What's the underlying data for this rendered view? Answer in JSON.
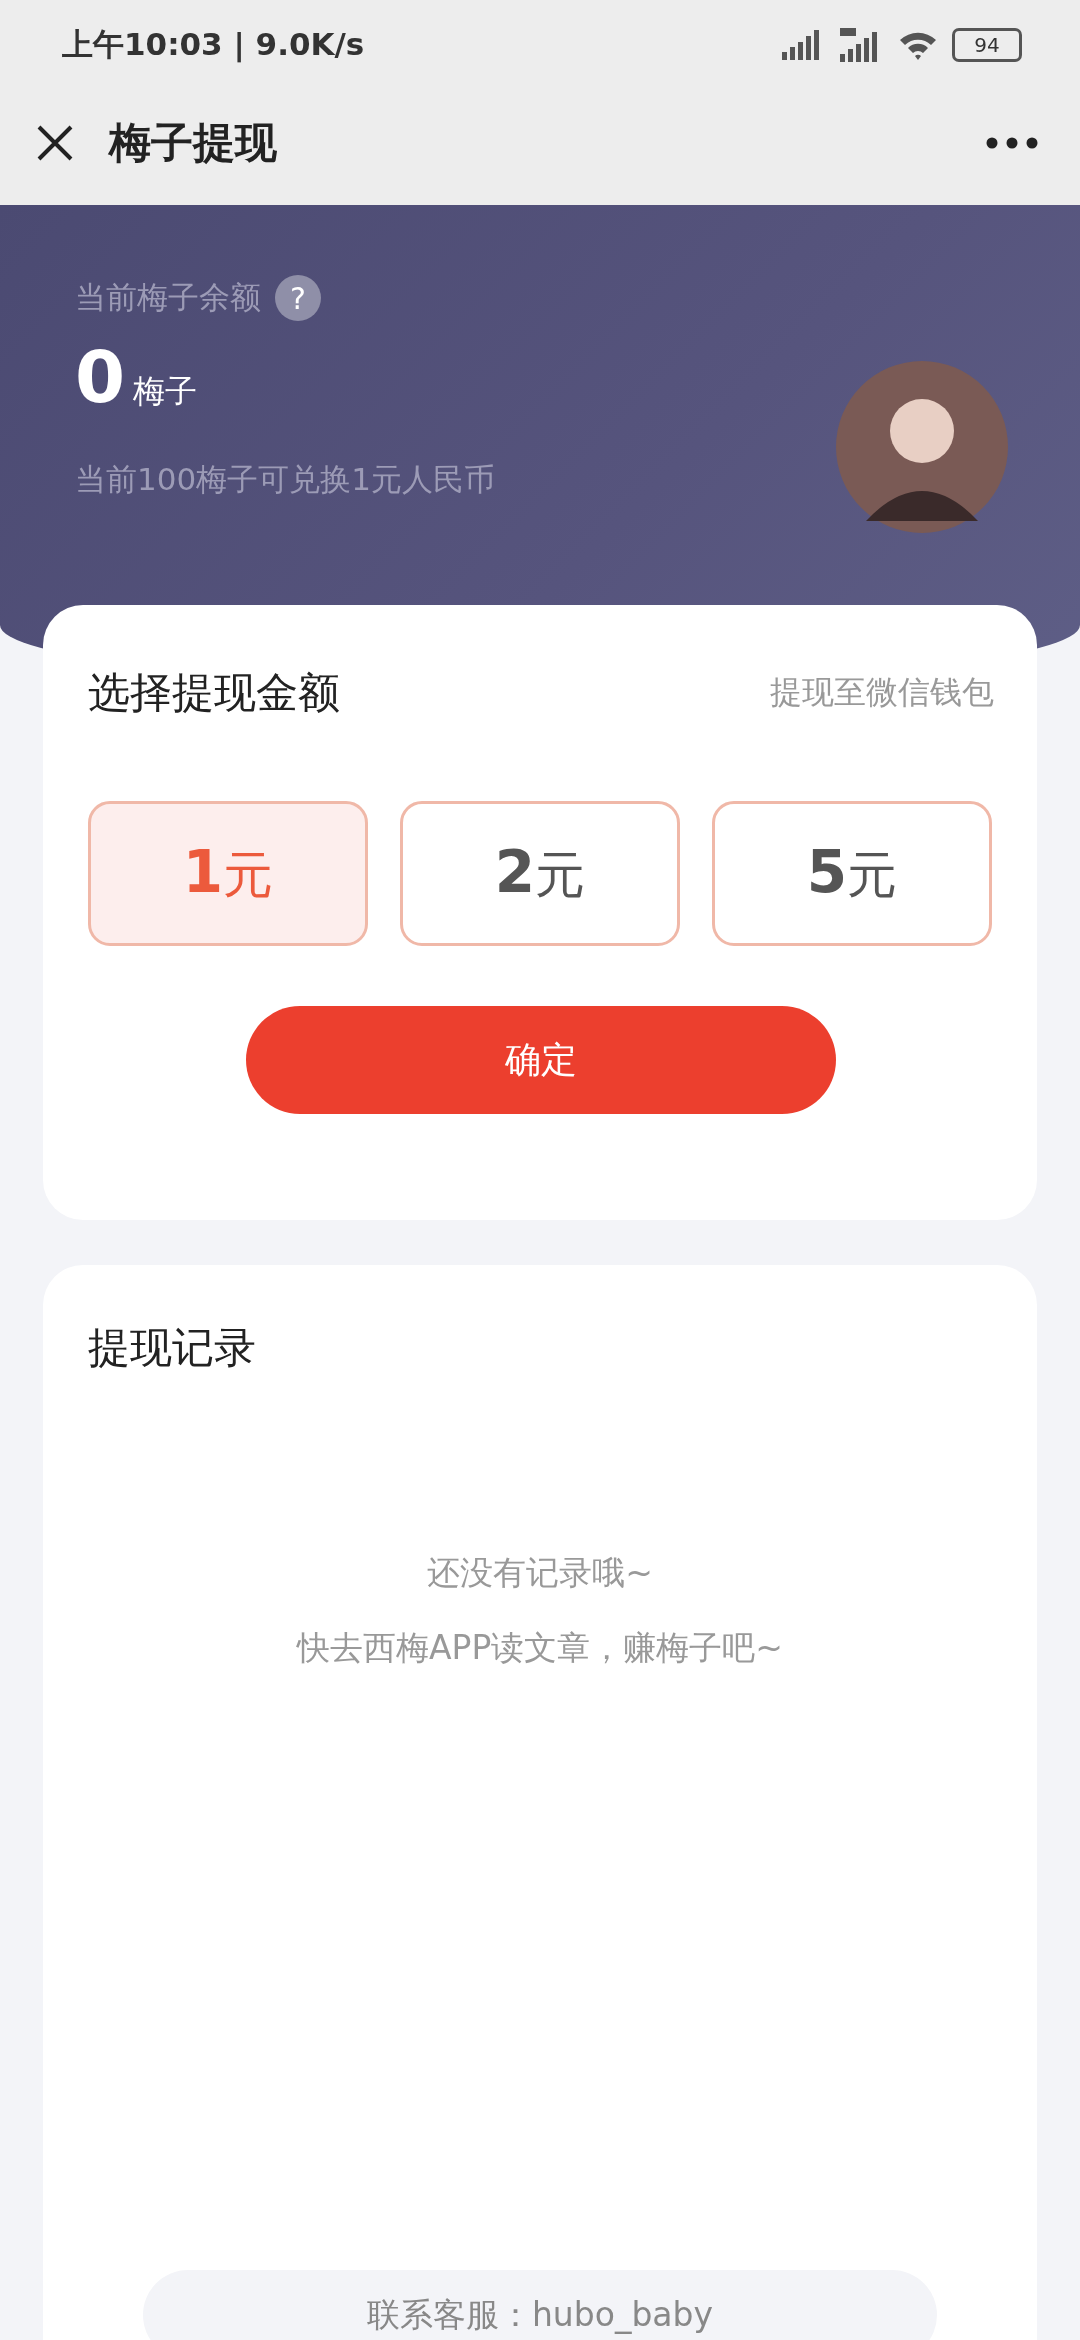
{
  "status_bar": {
    "time": "上午10:03 | 9.0K/s",
    "battery": "94"
  },
  "nav": {
    "title": "梅子提现"
  },
  "balance": {
    "label": "当前梅子余额",
    "help": "?",
    "amount": "0",
    "unit": "梅子",
    "rate_note": "当前100梅子可兑换1元人民币"
  },
  "withdraw": {
    "title": "选择提现金额",
    "destination": "提现至微信钱包",
    "options": [
      {
        "amount": "1",
        "unit": "元",
        "selected": true
      },
      {
        "amount": "2",
        "unit": "元",
        "selected": false
      },
      {
        "amount": "5",
        "unit": "元",
        "selected": false
      }
    ],
    "confirm": "确定"
  },
  "records": {
    "title": "提现记录",
    "empty_lines": [
      "还没有记录哦~",
      "快去西梅APP读文章，赚梅子吧~"
    ],
    "contact": "联系客服：hubo_baby"
  }
}
